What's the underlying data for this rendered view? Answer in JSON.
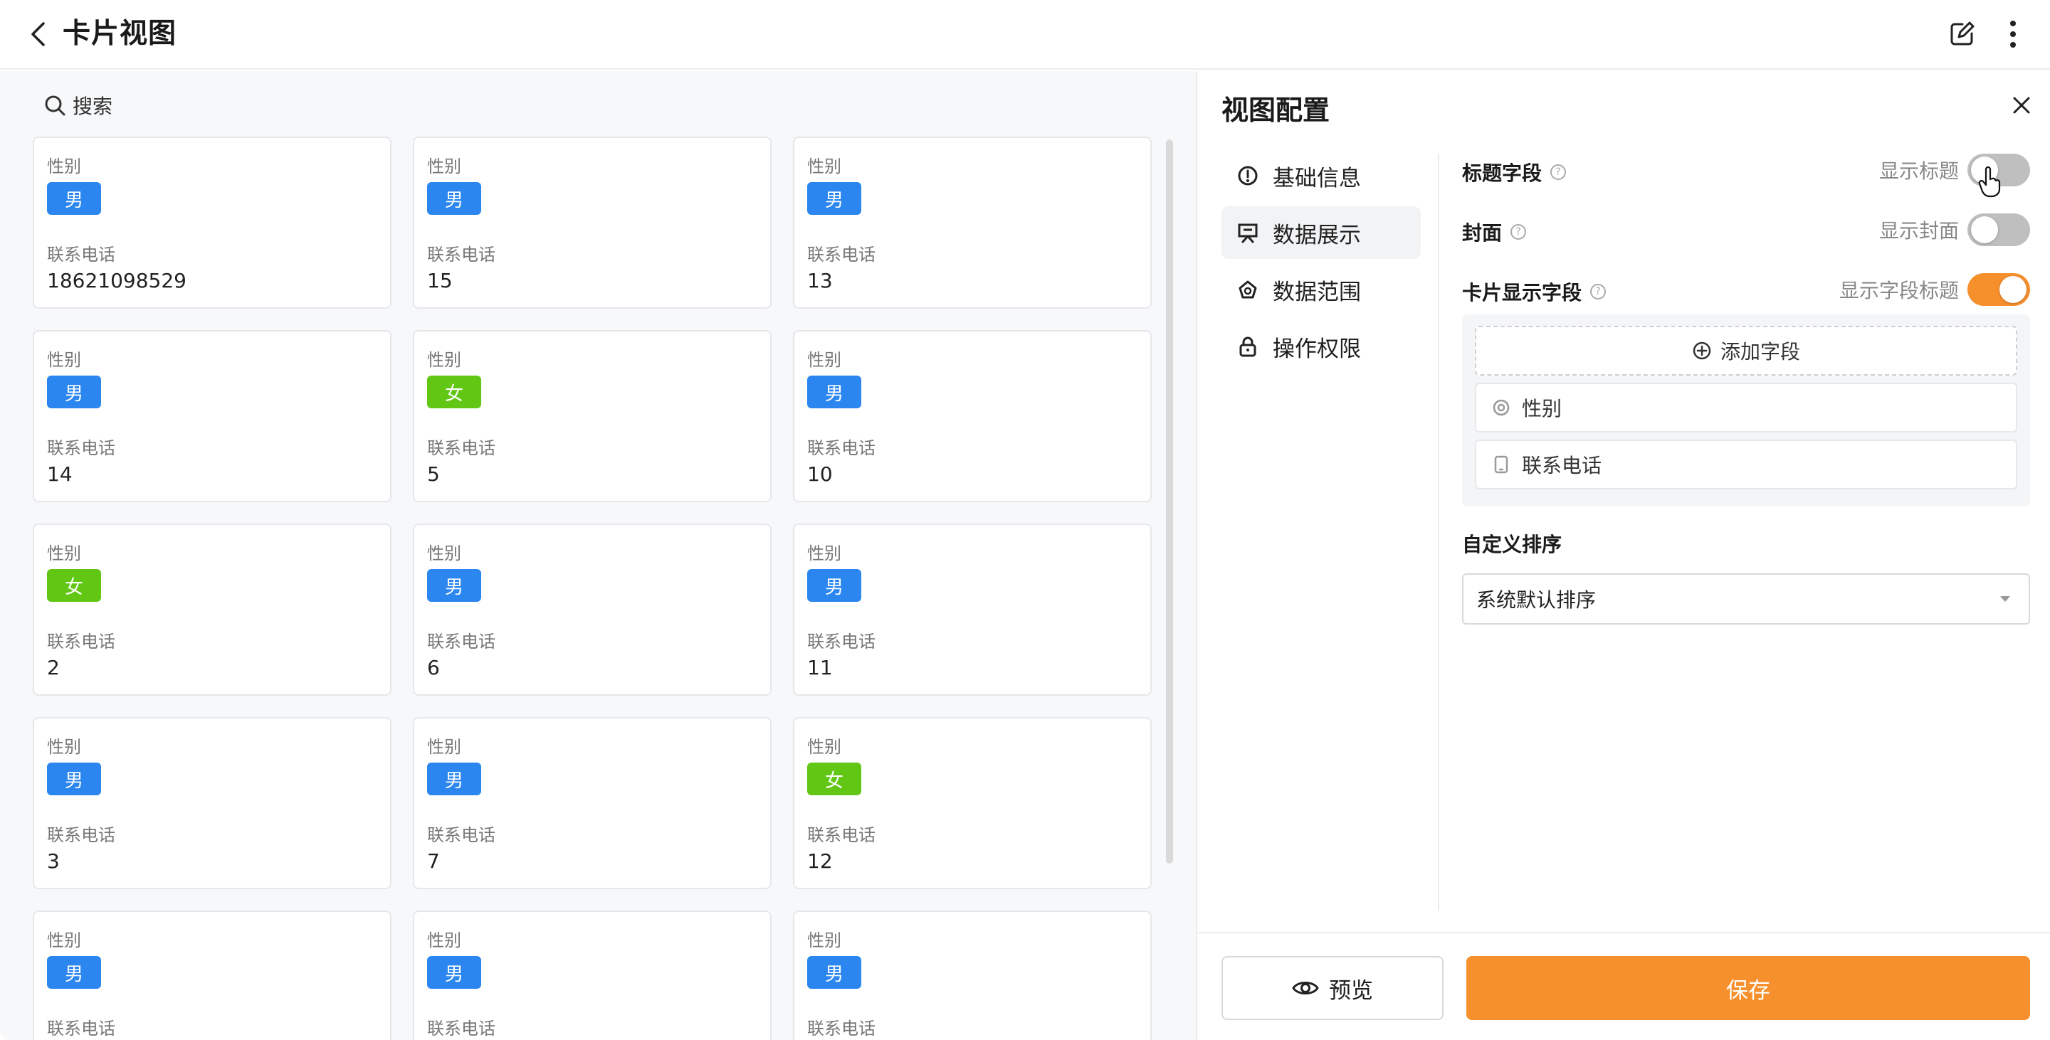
{
  "header": {
    "title": "卡片视图"
  },
  "search": {
    "label": "搜索"
  },
  "card_labels": {
    "gender": "性别",
    "phone": "联系电话"
  },
  "cards": [
    {
      "gender": "男",
      "phone": "18621098529"
    },
    {
      "gender": "男",
      "phone": "15"
    },
    {
      "gender": "男",
      "phone": "13"
    },
    {
      "gender": "男",
      "phone": "14"
    },
    {
      "gender": "女",
      "phone": "5"
    },
    {
      "gender": "男",
      "phone": "10"
    },
    {
      "gender": "女",
      "phone": "2"
    },
    {
      "gender": "男",
      "phone": "6"
    },
    {
      "gender": "男",
      "phone": "11"
    },
    {
      "gender": "男",
      "phone": "3"
    },
    {
      "gender": "男",
      "phone": "7"
    },
    {
      "gender": "女",
      "phone": "12"
    },
    {
      "gender": "男",
      "phone": ""
    },
    {
      "gender": "男",
      "phone": ""
    },
    {
      "gender": "男",
      "phone": ""
    }
  ],
  "colors": {
    "male": "#2b86ef",
    "female": "#61c714",
    "accent": "#f6902d"
  },
  "panel": {
    "title": "视图配置",
    "menu": [
      {
        "label": "基础信息",
        "icon": "info-circle-icon",
        "active": false
      },
      {
        "label": "数据展示",
        "icon": "presentation-icon",
        "active": true
      },
      {
        "label": "数据范围",
        "icon": "scope-icon",
        "active": false
      },
      {
        "label": "操作权限",
        "icon": "lock-icon",
        "active": false
      }
    ],
    "title_field": {
      "label": "标题字段",
      "toggle_label": "显示标题",
      "enabled": false
    },
    "cover": {
      "label": "封面",
      "toggle_label": "显示封面",
      "enabled": false
    },
    "card_fields": {
      "label": "卡片显示字段",
      "toggle_label": "显示字段标题",
      "enabled": true,
      "add_label": "添加字段",
      "items": [
        {
          "label": "性别",
          "icon": "radio-icon"
        },
        {
          "label": "联系电话",
          "icon": "phone-icon"
        }
      ]
    },
    "sort": {
      "title": "自定义排序",
      "selected": "系统默认排序"
    },
    "footer": {
      "preview": "预览",
      "save": "保存"
    }
  }
}
